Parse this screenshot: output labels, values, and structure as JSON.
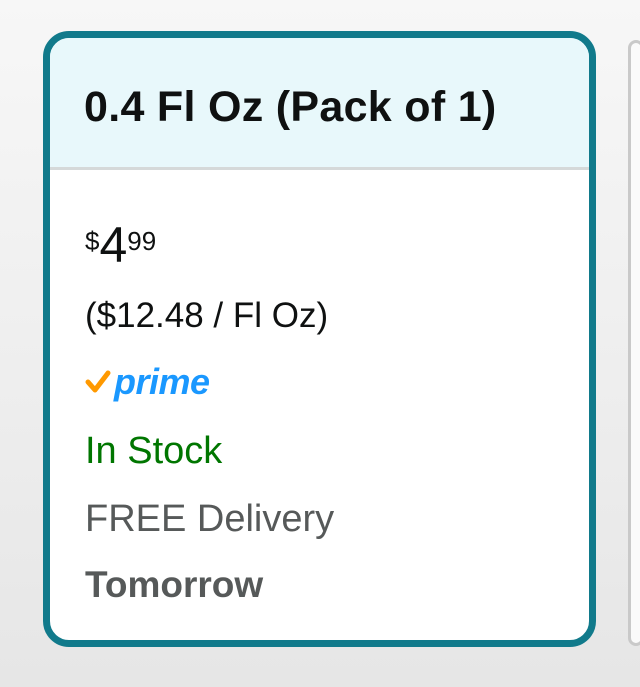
{
  "option": {
    "title": "0.4 Fl Oz (Pack of 1)",
    "price": {
      "symbol": "$",
      "whole": "4",
      "fraction": "99"
    },
    "unit_price": "($12.48 / Fl Oz)",
    "prime_label": "prime",
    "availability": "In Stock",
    "delivery_text": "FREE Delivery",
    "delivery_date": "Tomorrow"
  },
  "colors": {
    "card_border": "#117a8b",
    "header_bg": "#e8f8fb",
    "in_stock": "#007600",
    "prime_blue": "#1a98ff",
    "prime_check": "#ff9900",
    "secondary_text": "#565959"
  },
  "icons": {
    "prime_check": "checkmark-icon"
  }
}
